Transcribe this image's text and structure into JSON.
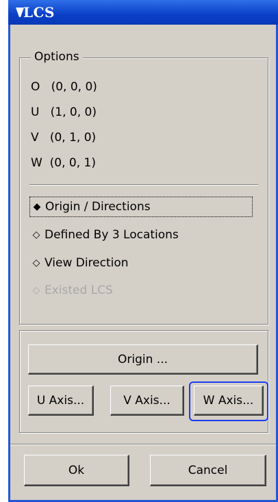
{
  "window": {
    "title": "LCS"
  },
  "options": {
    "legend": "Options",
    "coords": [
      {
        "axis": "O",
        "value": "(0, 0, 0)"
      },
      {
        "axis": "U",
        "value": "(1, 0, 0)"
      },
      {
        "axis": "V",
        "value": "(0, 1, 0)"
      },
      {
        "axis": "W",
        "value": "(0, 0, 1)"
      }
    ],
    "modes": [
      {
        "label": "Origin / Directions",
        "state": "selected",
        "mark": "◆"
      },
      {
        "label": "Defined By 3 Locations",
        "state": "normal",
        "mark": "◇"
      },
      {
        "label": "View Direction",
        "state": "normal",
        "mark": "◇"
      },
      {
        "label": "Existed LCS",
        "state": "disabled",
        "mark": "◇"
      }
    ]
  },
  "axes_buttons": {
    "origin": "Origin ...",
    "u_axis": "U Axis...",
    "v_axis": "V Axis...",
    "w_axis": "W Axis..."
  },
  "footer": {
    "ok": "Ok",
    "cancel": "Cancel"
  },
  "colors": {
    "titlebar": "#0a3fc8",
    "dialog_face": "#d4d0c8",
    "focus_ring": "#1b3cf0"
  }
}
